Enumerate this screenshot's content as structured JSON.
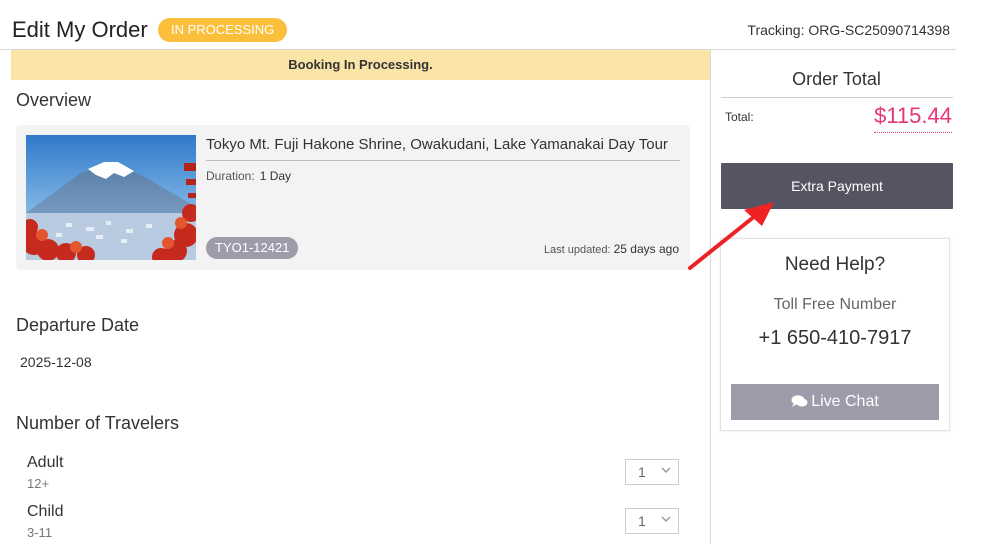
{
  "header": {
    "title": "Edit My Order",
    "status": "IN PROCESSING",
    "tracking": "Tracking: ORG-SC25090714398"
  },
  "banner": "Booking In Processing.",
  "overview": {
    "title": "Overview",
    "tour_name": "Tokyo Mt. Fuji Hakone Shrine, Owakudani, Lake Yamanakai Day Tour",
    "duration_label": "Duration:",
    "duration_value": "1 Day",
    "product_code": "TYO1-12421",
    "updated_label": "Last updated:",
    "updated_value": "25 days ago"
  },
  "departure": {
    "title": "Departure Date",
    "value": "2025-12-08"
  },
  "travelers": {
    "title": "Number of Travelers",
    "items": [
      {
        "label": "Adult",
        "age": "12+",
        "qty": "1"
      },
      {
        "label": "Child",
        "age": "3-11",
        "qty": "1"
      }
    ]
  },
  "order_total": {
    "title": "Order Total",
    "label": "Total:",
    "value": "$115.44"
  },
  "extra_payment": "Extra Payment",
  "help": {
    "title": "Need Help?",
    "toll_label": "Toll Free Number",
    "phone": "+1 650-410-7917",
    "chat": "Live Chat"
  },
  "colors": {
    "badge": "#fbbf3c",
    "banner": "#fbe4a8",
    "total": "#e8347a",
    "primary_button": "#545462",
    "secondary_button": "#9c9cab",
    "annotation_arrow": "#ee2222"
  }
}
